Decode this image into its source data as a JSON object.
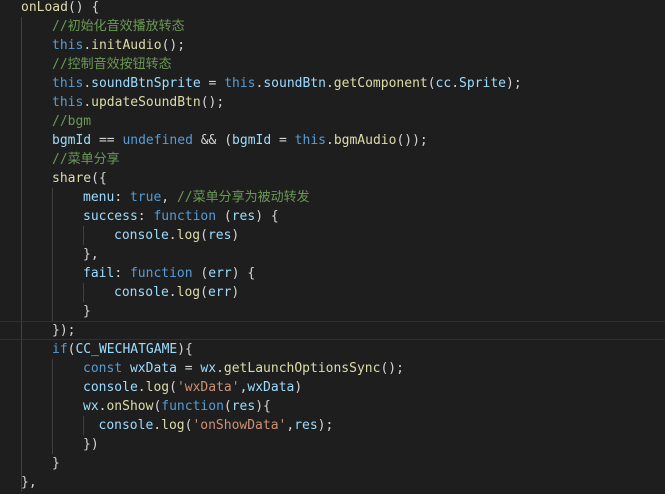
{
  "editor": {
    "theme": {
      "background": "#1e1e1e",
      "foreground": "#d4d4d4",
      "keyword": "#569cd6",
      "function": "#dcdcaa",
      "variable": "#9cdcfe",
      "comment": "#6a9955",
      "string": "#ce9178"
    },
    "lines": [
      {
        "indent": 0,
        "tokens": [
          {
            "t": "onLoad",
            "c": "fn"
          },
          {
            "t": "() {",
            "c": "pun"
          }
        ]
      },
      {
        "indent": 1,
        "tokens": [
          {
            "t": "//初始化音效播放转态",
            "c": "cm"
          }
        ]
      },
      {
        "indent": 1,
        "tokens": [
          {
            "t": "this",
            "c": "kw"
          },
          {
            "t": ".",
            "c": "pun"
          },
          {
            "t": "initAudio",
            "c": "fn"
          },
          {
            "t": "();",
            "c": "pun"
          }
        ]
      },
      {
        "indent": 1,
        "tokens": [
          {
            "t": "//控制音效按钮转态",
            "c": "cm"
          }
        ]
      },
      {
        "indent": 1,
        "tokens": [
          {
            "t": "this",
            "c": "kw"
          },
          {
            "t": ".",
            "c": "pun"
          },
          {
            "t": "soundBtnSprite",
            "c": "var"
          },
          {
            "t": " = ",
            "c": "pun"
          },
          {
            "t": "this",
            "c": "kw"
          },
          {
            "t": ".",
            "c": "pun"
          },
          {
            "t": "soundBtn",
            "c": "var"
          },
          {
            "t": ".",
            "c": "pun"
          },
          {
            "t": "getComponent",
            "c": "fn"
          },
          {
            "t": "(",
            "c": "pun"
          },
          {
            "t": "cc",
            "c": "var"
          },
          {
            "t": ".",
            "c": "pun"
          },
          {
            "t": "Sprite",
            "c": "var"
          },
          {
            "t": ");",
            "c": "pun"
          }
        ]
      },
      {
        "indent": 1,
        "tokens": [
          {
            "t": "this",
            "c": "kw"
          },
          {
            "t": ".",
            "c": "pun"
          },
          {
            "t": "updateSoundBtn",
            "c": "fn"
          },
          {
            "t": "();",
            "c": "pun"
          }
        ]
      },
      {
        "indent": 1,
        "tokens": [
          {
            "t": "//bgm",
            "c": "cm"
          }
        ]
      },
      {
        "indent": 1,
        "tokens": [
          {
            "t": "bgmId",
            "c": "var"
          },
          {
            "t": " == ",
            "c": "pun"
          },
          {
            "t": "undefined",
            "c": "kw"
          },
          {
            "t": " && (",
            "c": "pun"
          },
          {
            "t": "bgmId",
            "c": "var"
          },
          {
            "t": " = ",
            "c": "pun"
          },
          {
            "t": "this",
            "c": "kw"
          },
          {
            "t": ".",
            "c": "pun"
          },
          {
            "t": "bgmAudio",
            "c": "fn"
          },
          {
            "t": "());",
            "c": "pun"
          }
        ]
      },
      {
        "indent": 1,
        "tokens": [
          {
            "t": "//菜单分享",
            "c": "cm"
          }
        ]
      },
      {
        "indent": 1,
        "tokens": [
          {
            "t": "share",
            "c": "fn"
          },
          {
            "t": "({",
            "c": "pun"
          }
        ]
      },
      {
        "indent": 2,
        "tokens": [
          {
            "t": "menu",
            "c": "var"
          },
          {
            "t": ": ",
            "c": "pun"
          },
          {
            "t": "true",
            "c": "kw"
          },
          {
            "t": ", ",
            "c": "pun"
          },
          {
            "t": "//菜单分享为被动转发",
            "c": "cm"
          }
        ]
      },
      {
        "indent": 2,
        "tokens": [
          {
            "t": "success",
            "c": "var"
          },
          {
            "t": ": ",
            "c": "pun"
          },
          {
            "t": "function",
            "c": "kw"
          },
          {
            "t": " (",
            "c": "pun"
          },
          {
            "t": "res",
            "c": "var"
          },
          {
            "t": ") {",
            "c": "pun"
          }
        ]
      },
      {
        "indent": 3,
        "tokens": [
          {
            "t": "console",
            "c": "var"
          },
          {
            "t": ".",
            "c": "pun"
          },
          {
            "t": "log",
            "c": "fn"
          },
          {
            "t": "(",
            "c": "pun"
          },
          {
            "t": "res",
            "c": "var"
          },
          {
            "t": ")",
            "c": "pun"
          }
        ]
      },
      {
        "indent": 2,
        "tokens": [
          {
            "t": "},",
            "c": "pun"
          }
        ]
      },
      {
        "indent": 2,
        "tokens": [
          {
            "t": "fail",
            "c": "var"
          },
          {
            "t": ": ",
            "c": "pun"
          },
          {
            "t": "function",
            "c": "kw"
          },
          {
            "t": " (",
            "c": "pun"
          },
          {
            "t": "err",
            "c": "var"
          },
          {
            "t": ") {",
            "c": "pun"
          }
        ]
      },
      {
        "indent": 3,
        "tokens": [
          {
            "t": "console",
            "c": "var"
          },
          {
            "t": ".",
            "c": "pun"
          },
          {
            "t": "log",
            "c": "fn"
          },
          {
            "t": "(",
            "c": "pun"
          },
          {
            "t": "err",
            "c": "var"
          },
          {
            "t": ")",
            "c": "pun"
          }
        ]
      },
      {
        "indent": 2,
        "tokens": [
          {
            "t": "}",
            "c": "pun"
          }
        ]
      },
      {
        "indent": 1,
        "tokens": [
          {
            "t": "});",
            "c": "pun"
          }
        ],
        "highlight": true
      },
      {
        "indent": 1,
        "tokens": [
          {
            "t": "if",
            "c": "kw"
          },
          {
            "t": "(",
            "c": "pun"
          },
          {
            "t": "CC_WECHATGAME",
            "c": "var"
          },
          {
            "t": "){",
            "c": "pun"
          }
        ]
      },
      {
        "indent": 2,
        "tokens": [
          {
            "t": "const",
            "c": "kw"
          },
          {
            "t": " ",
            "c": "pun"
          },
          {
            "t": "wxData",
            "c": "var"
          },
          {
            "t": " = ",
            "c": "pun"
          },
          {
            "t": "wx",
            "c": "var"
          },
          {
            "t": ".",
            "c": "pun"
          },
          {
            "t": "getLaunchOptionsSync",
            "c": "fn"
          },
          {
            "t": "();",
            "c": "pun"
          }
        ]
      },
      {
        "indent": 2,
        "tokens": [
          {
            "t": "console",
            "c": "var"
          },
          {
            "t": ".",
            "c": "pun"
          },
          {
            "t": "log",
            "c": "fn"
          },
          {
            "t": "(",
            "c": "pun"
          },
          {
            "t": "'wxData'",
            "c": "str"
          },
          {
            "t": ",",
            "c": "pun"
          },
          {
            "t": "wxData",
            "c": "var"
          },
          {
            "t": ")",
            "c": "pun"
          }
        ]
      },
      {
        "indent": 2,
        "tokens": [
          {
            "t": "wx",
            "c": "var"
          },
          {
            "t": ".",
            "c": "pun"
          },
          {
            "t": "onShow",
            "c": "fn"
          },
          {
            "t": "(",
            "c": "pun"
          },
          {
            "t": "function",
            "c": "kw"
          },
          {
            "t": "(",
            "c": "pun"
          },
          {
            "t": "res",
            "c": "var"
          },
          {
            "t": "){",
            "c": "pun"
          }
        ]
      },
      {
        "indent": 2.5,
        "tokens": [
          {
            "t": "console",
            "c": "var"
          },
          {
            "t": ".",
            "c": "pun"
          },
          {
            "t": "log",
            "c": "fn"
          },
          {
            "t": "(",
            "c": "pun"
          },
          {
            "t": "'onShowData'",
            "c": "str"
          },
          {
            "t": ",",
            "c": "pun"
          },
          {
            "t": "res",
            "c": "var"
          },
          {
            "t": ");",
            "c": "pun"
          }
        ]
      },
      {
        "indent": 2,
        "tokens": [
          {
            "t": "})",
            "c": "pun"
          }
        ]
      },
      {
        "indent": 1,
        "tokens": [
          {
            "t": "}",
            "c": "pun"
          }
        ]
      },
      {
        "indent": 0,
        "tokens": [
          {
            "t": "},",
            "c": "pun"
          }
        ]
      }
    ]
  }
}
